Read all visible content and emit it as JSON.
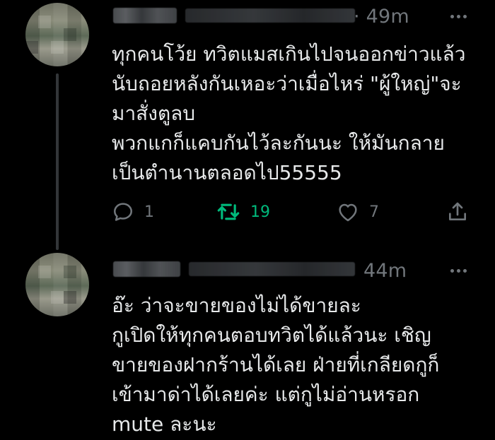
{
  "colors": {
    "background": "#000000",
    "text": "#e7e9ea",
    "muted": "#71767b",
    "retweet_active": "#00ba7c",
    "thread_line": "#333639"
  },
  "tweets": [
    {
      "time": "· 49m",
      "lines": [
        "ทุกคนโว้ย ทวิตแมสเกินไปจนออกข่าวแล้ว",
        "นับถอยหลังกันเหอะว่าเมื่อไหร่ \"ผู้ใหญ่\"จะ",
        "มาสั่งตูลบ",
        "พวกแกก็แคบกันไว้ละกันนะ ให้มันกลาย",
        "เป็นตำนานตลอดไป55555"
      ],
      "actions": {
        "reply_count": "1",
        "retweet_count": "19",
        "like_count": "7"
      },
      "icons": [
        "reply-icon",
        "retweet-icon",
        "like-icon",
        "share-icon",
        "more-icon"
      ]
    },
    {
      "time": "44m",
      "lines": [
        "อ๊ะ ว่าจะขายของไม่ได้ขายละ",
        "กูเปิดให้ทุกคนตอบทวิตได้แล้วนะ เชิญ",
        "ขายของฝากร้านได้เลย ฝ่ายที่เกลียดกูก็",
        "เข้ามาด่าได้เลยค่ะ แต่กูไม่อ่านหรอก",
        "mute ละนะ"
      ],
      "icons": [
        "more-icon"
      ]
    }
  ]
}
